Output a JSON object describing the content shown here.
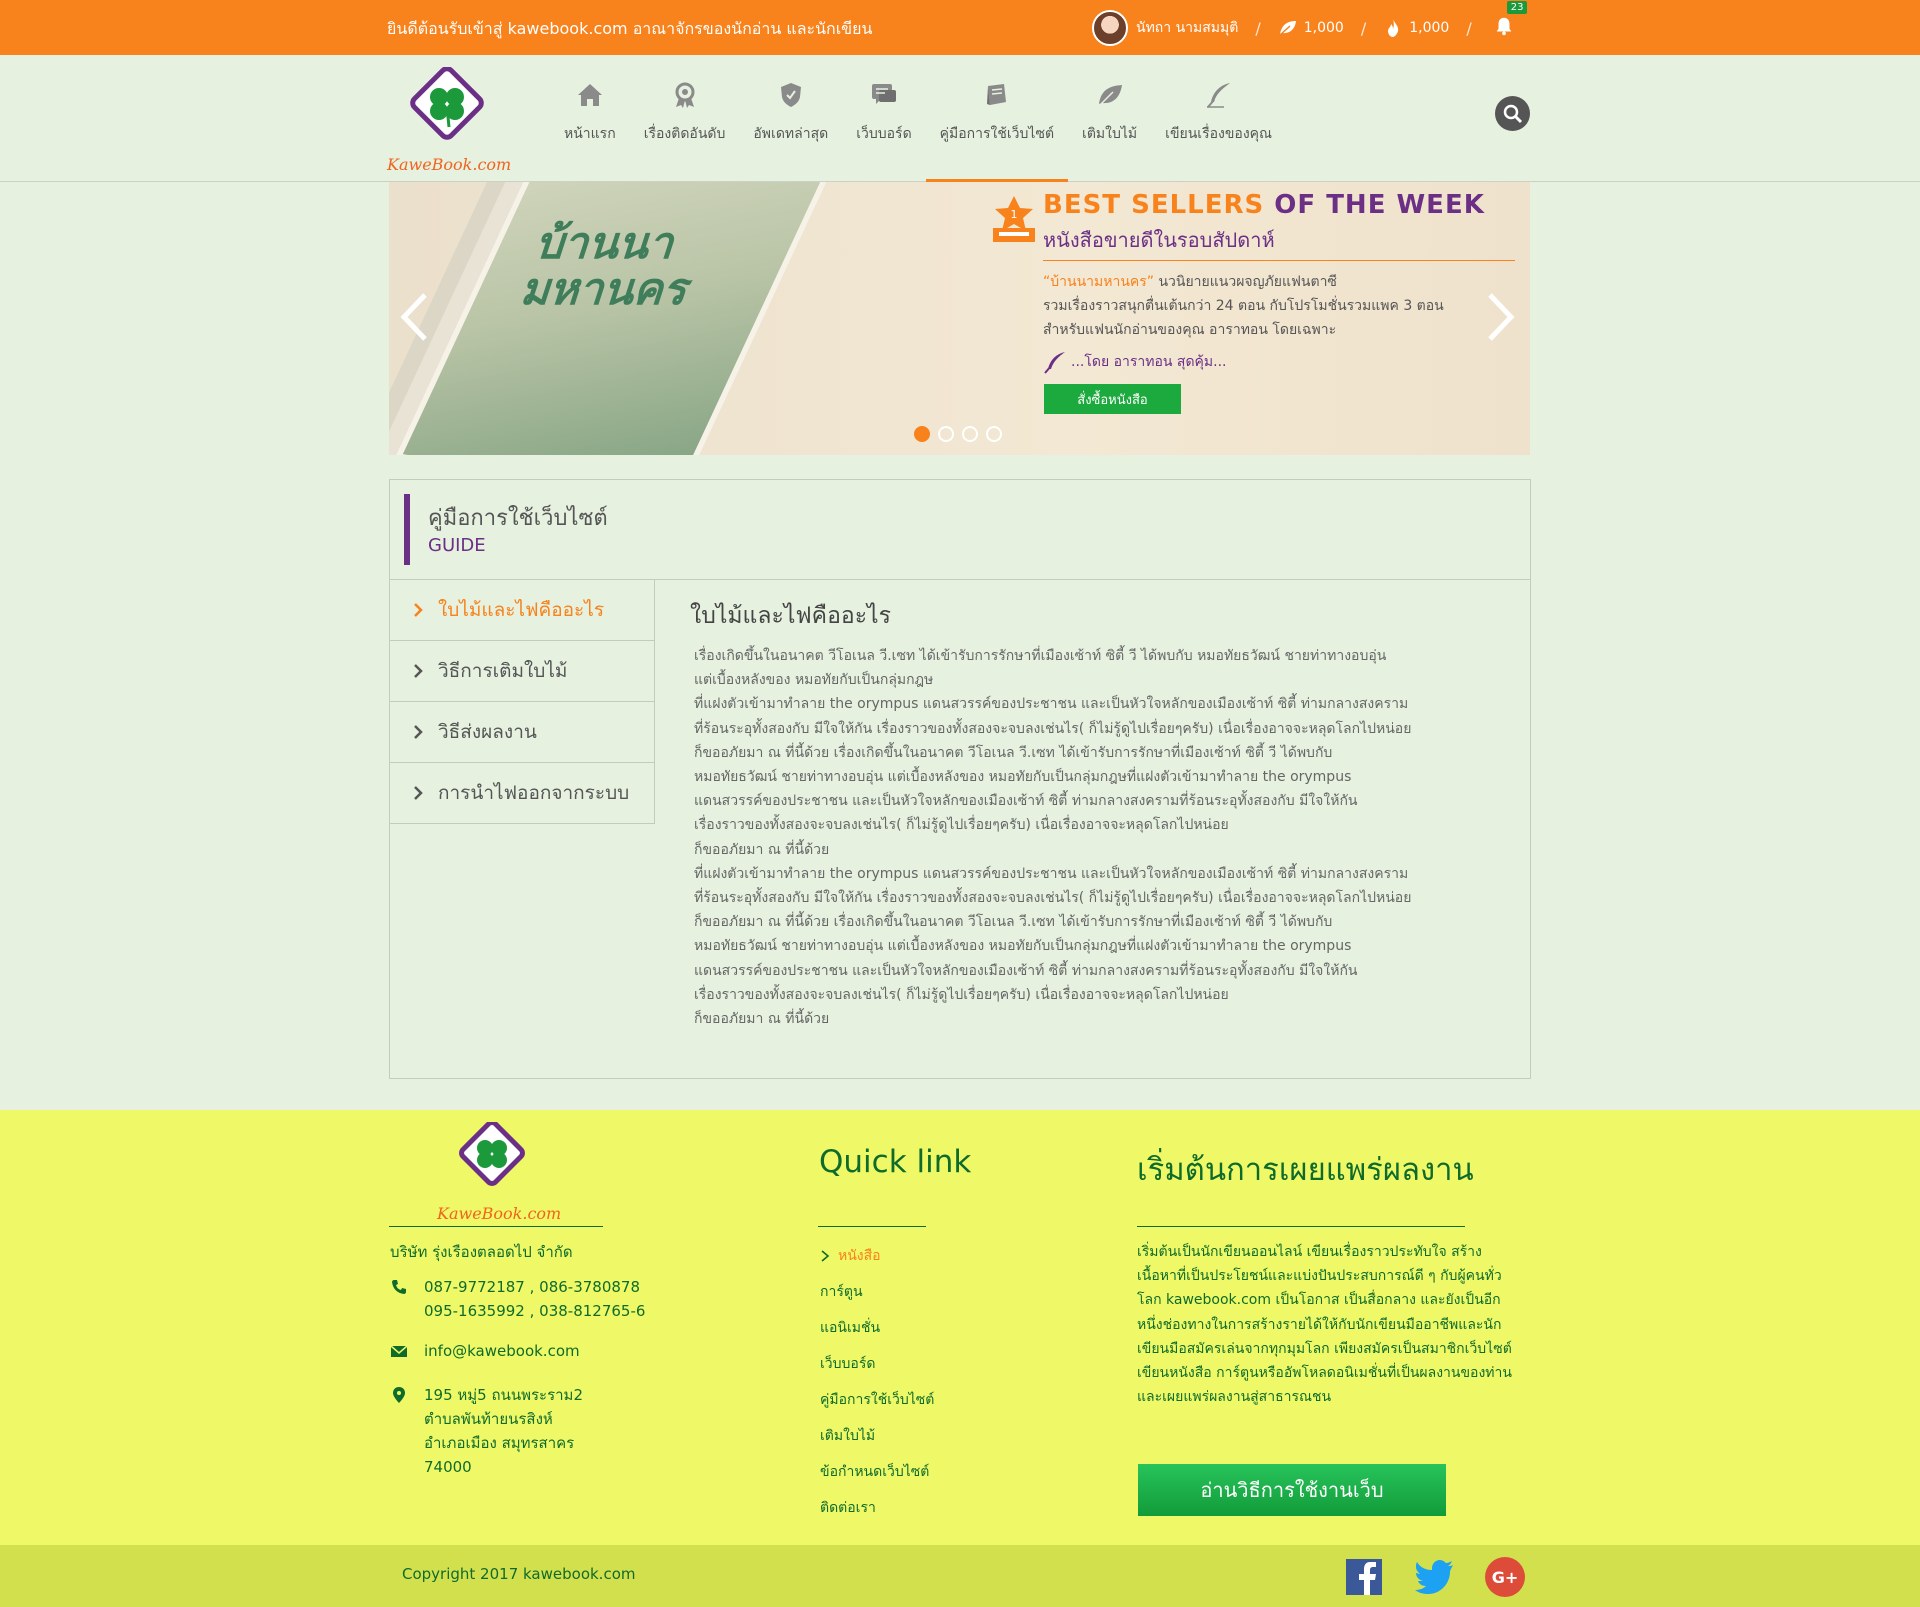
{
  "topbar": {
    "welcome": "ยินดีต้อนรับเข้าสู่ kawebook.com อาณาจักรของนักอ่าน และนักเขียน",
    "username": "นัทถา นามสมมุติ",
    "leaf_count": "1,000",
    "fire_count": "1,000",
    "notification_count": "23"
  },
  "logo": {
    "text": "KaweBook.com"
  },
  "nav": {
    "items": [
      {
        "label": "หน้าแรก",
        "icon": "home-icon"
      },
      {
        "label": "เรื่องติดอันดับ",
        "icon": "award-icon"
      },
      {
        "label": "อัพเดทล่าสุด",
        "icon": "shield-icon"
      },
      {
        "label": "เว็บบอร์ด",
        "icon": "chat-icon"
      },
      {
        "label": "คู่มือการใช้เว็บไซต์",
        "icon": "book-icon",
        "active": true
      },
      {
        "label": "เติมใบไม้",
        "icon": "leaf-icon"
      },
      {
        "label": "เขียนเรื่องของคุณ",
        "icon": "quill-icon"
      }
    ]
  },
  "banner": {
    "book_title": "บ้านนามหานคร",
    "title_orange": "BEST SELLERS",
    "title_purple": "OF THE WEEK",
    "subtitle": "หนังสือขายดีในรอบสัปดาห์",
    "quote": "“บ้านนามหานคร”",
    "desc_1": " นวนิยายแนวผจญภัยแฟนตาซี",
    "desc_2": "รวมเรื่องราวสนุกตื่นเต้นกว่า 24 ตอน กับโปรโมชั่นรวมแพค 3 ตอน",
    "desc_3": "สำหรับแฟนนักอ่านของคุณ อาราทอน โดยเฉพาะ",
    "by": "...โดย อาราทอน สุดคุ้ม...",
    "button": "สั่งซื้อหนังสือ",
    "active_slide": 1,
    "total_slides": 4
  },
  "guide": {
    "title_th": "คู่มือการใช้เว็บไซต์",
    "title_en": "GUIDE",
    "menu": [
      {
        "label": "ใบไม้และไฟคืออะไร",
        "active": true
      },
      {
        "label": "วิธีการเติมใบไม้"
      },
      {
        "label": "วิธีส่งผลงาน"
      },
      {
        "label": "การนำไฟออกจากระบบ"
      }
    ],
    "content_title": "ใบไม้และไฟคืออะไร",
    "content_body": "เรื่องเกิดขึ้นในอนาคต วีโอเนล วี.เซท ได้เข้ารับการรักษาที่เมืองเซ้าท์ ซิตี้  วี ได้พบกับ หมอทัยธวัฒน์ ชายท่าทางอบอุ่น\nแต่เบื้องหลังของ หมอทัยกับเป็นกลุ่มกฎษ\nที่แฝงตัวเข้ามาทำลาย the orympus แดนสวรรค์ของประชาชน และเป็นหัวใจหลักของเมืองเซ้าท์ ซิตี้ ท่ามกลางสงคราม\nที่ร้อนระอุทั้งสองกับ มีใจให้กัน เรื่องราวของทั้งสองจะจบลงเช่นไร( ก็ไม่รู้ดูไปเรื่อยๆครับ)  เนื่อเรื่องอาจจะหลุดโลกไปหน่อย\nก็ขออภัยมา ณ ที่นี้ด้วย เรื่องเกิดขึ้นในอนาคต วีโอเนล วี.เซท ได้เข้ารับการรักษาที่เมืองเซ้าท์ ซิตี้  วี ได้พบกับ\nหมอทัยธวัฒน์ ชายท่าทางอบอุ่น แต่เบื้องหลังของ หมอทัยกับเป็นกลุ่มกฎษที่แฝงตัวเข้ามาทำลาย the orympus\nแดนสวรรค์ของประชาชน และเป็นหัวใจหลักของเมืองเซ้าท์ ซิตี้ ท่ามกลางสงครามที่ร้อนระอุทั้งสองกับ มีใจให้กัน\nเรื่องราวของทั้งสองจะจบลงเช่นไร( ก็ไม่รู้ดูไปเรื่อยๆครับ)  เนื่อเรื่องอาจจะหลุดโลกไปหน่อย\nก็ขออภัยมา ณ ที่นี้ด้วย\nที่แฝงตัวเข้ามาทำลาย the orympus แดนสวรรค์ของประชาชน และเป็นหัวใจหลักของเมืองเซ้าท์ ซิตี้ ท่ามกลางสงคราม\nที่ร้อนระอุทั้งสองกับ มีใจให้กัน เรื่องราวของทั้งสองจะจบลงเช่นไร( ก็ไม่รู้ดูไปเรื่อยๆครับ)  เนื่อเรื่องอาจจะหลุดโลกไปหน่อย\nก็ขออภัยมา ณ ที่นี้ด้วย เรื่องเกิดขึ้นในอนาคต วีโอเนล วี.เซท ได้เข้ารับการรักษาที่เมืองเซ้าท์ ซิตี้  วี ได้พบกับ\nหมอทัยธวัฒน์ ชายท่าทางอบอุ่น แต่เบื้องหลังของ หมอทัยกับเป็นกลุ่มกฎษที่แฝงตัวเข้ามาทำลาย the orympus\nแดนสวรรค์ของประชาชน และเป็นหัวใจหลักของเมืองเซ้าท์ ซิตี้ ท่ามกลางสงครามที่ร้อนระอุทั้งสองกับ มีใจให้กัน\nเรื่องราวของทั้งสองจะจบลงเช่นไร( ก็ไม่รู้ดูไปเรื่อยๆครับ)  เนื่อเรื่องอาจจะหลุดโลกไปหน่อย\nก็ขออภัยมา ณ ที่นี้ด้วย"
  },
  "footer": {
    "company": "บริษัท รุ่งเรืองตลอดไป จำกัด",
    "phone_1": "087-9772187 , 086-3780878",
    "phone_2": "095-1635992 , 038-812765-6",
    "email": "info@kawebook.com",
    "address": "195 หมู่5 ถนนพระราม2\nตำบลพันท้ายนรสิงห์\nอำเภอเมือง สมุทรสาคร\n74000",
    "quicklink_title": "Quick link",
    "quicklinks": [
      "หนังสือ",
      "การ์ตูน",
      "แอนิเมชั่น",
      "เว็บบอร์ด",
      "คู่มือการใช้เว็บไซต์",
      "เติมใบไม้",
      "ข้อกำหนดเว็บไซต์",
      "ติดต่อเรา"
    ],
    "publish_title": "เริ่มต้นการเผยแพร่ผลงาน",
    "publish_desc": "เริ่มต้นเป็นนักเขียนออนไลน์ เขียนเรื่องราวประทับใจ สร้างเนื้อหาที่เป็นประโยชน์และแบ่งปันประสบการณ์ดี ๆ กับผู้คนทั่วโลก kawebook.com เป็นโอกาส เป็นสื่อกลาง และยังเป็นอีกหนึ่งช่องทางในการสร้างรายได้ให้กับนักเขียนมืออาชีพและนักเขียนมือสมัครเล่นจากทุกมุมโลก เพียงสมัครเป็นสมาชิกเว็บไซต์เขียนหนังสือ การ์ตูนหรืออัพโหลดอนิเมชั่นที่เป็นผลงานของท่าน และเผยแพร่ผลงานสู่สาธารณชน",
    "publish_button": "อ่านวิธีการใช้งานเว็บ",
    "copyright": "Copyright 2017 kawebook.com"
  },
  "colors": {
    "accent_orange": "#f8821b",
    "brand_purple": "#6b2f86",
    "brand_green": "#0f6b2a",
    "footer_yellow": "#eff968"
  }
}
